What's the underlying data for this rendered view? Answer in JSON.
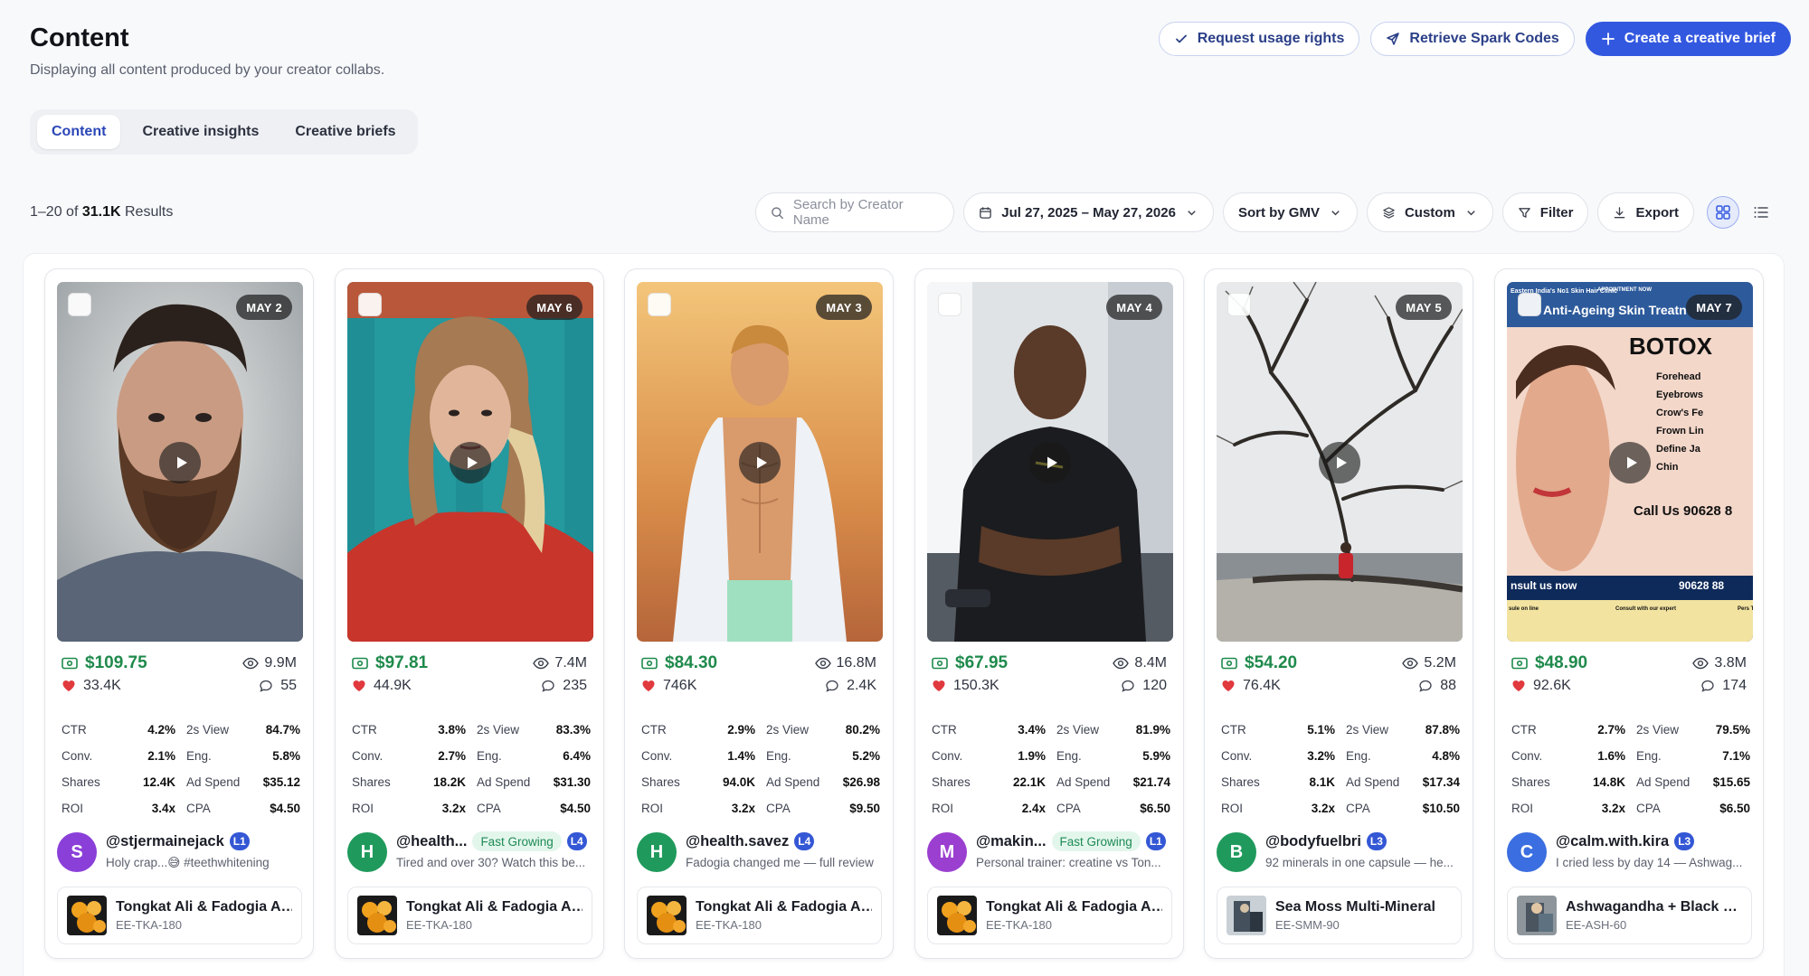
{
  "header": {
    "title": "Content",
    "subtitle": "Displaying all content produced by your creator collabs."
  },
  "actions": {
    "request_usage": "Request usage rights",
    "retrieve_spark": "Retrieve Spark Codes",
    "create_brief": "Create a creative brief"
  },
  "tabs": [
    "Content",
    "Creative insights",
    "Creative briefs"
  ],
  "results": {
    "range": "1–20 of",
    "total": "31.1K",
    "suffix": "Results"
  },
  "toolbar": {
    "search_placeholder": "Search by Creator Name",
    "date_range": "Jul 27, 2025 – May 27, 2026",
    "sort": "Sort by GMV",
    "custom": "Custom",
    "filter": "Filter",
    "export": "Export"
  },
  "metric_labels": {
    "ctr": "CTR",
    "view2s": "2s View",
    "conv": "Conv.",
    "eng": "Eng.",
    "shares": "Shares",
    "adspend": "Ad Spend",
    "roi": "ROI",
    "cpa": "CPA"
  },
  "cards": [
    {
      "date": "MAY 2",
      "gmv": "$109.75",
      "views": "9.9M",
      "likes": "33.4K",
      "comments": "55",
      "ctr": "4.2%",
      "view2s": "84.7%",
      "conv": "2.1%",
      "eng": "5.8%",
      "shares": "12.4K",
      "adspend": "$35.12",
      "roi": "3.4x",
      "cpa": "$4.50",
      "avatar_letter": "S",
      "avatar_color": "#8b3fd9",
      "handle": "@stjermainejack",
      "badge": "",
      "level": "L1",
      "caption": "Holy crap...😅 #teethwhitening",
      "product": "Tongkat Ali & Fadogia Ag...",
      "sku": "EE-TKA-180"
    },
    {
      "date": "MAY 6",
      "gmv": "$97.81",
      "views": "7.4M",
      "likes": "44.9K",
      "comments": "235",
      "ctr": "3.8%",
      "view2s": "83.3%",
      "conv": "2.7%",
      "eng": "6.4%",
      "shares": "18.2K",
      "adspend": "$31.30",
      "roi": "3.2x",
      "cpa": "$4.50",
      "avatar_letter": "H",
      "avatar_color": "#1f9a5c",
      "handle": "@health...",
      "badge": "Fast Growing",
      "level": "L4",
      "caption": "Tired and over 30? Watch this be...",
      "product": "Tongkat Ali & Fadogia Ag...",
      "sku": "EE-TKA-180"
    },
    {
      "date": "MAY 3",
      "gmv": "$84.30",
      "views": "16.8M",
      "likes": "746K",
      "comments": "2.4K",
      "ctr": "2.9%",
      "view2s": "80.2%",
      "conv": "1.4%",
      "eng": "5.2%",
      "shares": "94.0K",
      "adspend": "$26.98",
      "roi": "3.2x",
      "cpa": "$9.50",
      "avatar_letter": "H",
      "avatar_color": "#1f9a5c",
      "handle": "@health.savez",
      "badge": "",
      "level": "L4",
      "caption": "Fadogia changed me — full review",
      "product": "Tongkat Ali & Fadogia Ag...",
      "sku": "EE-TKA-180"
    },
    {
      "date": "MAY 4",
      "gmv": "$67.95",
      "views": "8.4M",
      "likes": "150.3K",
      "comments": "120",
      "ctr": "3.4%",
      "view2s": "81.9%",
      "conv": "1.9%",
      "eng": "5.9%",
      "shares": "22.1K",
      "adspend": "$21.74",
      "roi": "2.4x",
      "cpa": "$6.50",
      "avatar_letter": "M",
      "avatar_color": "#9b3fd0",
      "handle": "@makin...",
      "badge": "Fast Growing",
      "level": "L1",
      "caption": "Personal trainer: creatine vs Ton...",
      "product": "Tongkat Ali & Fadogia Ag...",
      "sku": "EE-TKA-180"
    },
    {
      "date": "MAY 5",
      "gmv": "$54.20",
      "views": "5.2M",
      "likes": "76.4K",
      "comments": "88",
      "ctr": "5.1%",
      "view2s": "87.8%",
      "conv": "3.2%",
      "eng": "4.8%",
      "shares": "8.1K",
      "adspend": "$17.34",
      "roi": "3.2x",
      "cpa": "$10.50",
      "avatar_letter": "B",
      "avatar_color": "#1f9a5c",
      "handle": "@bodyfuelbri",
      "badge": "",
      "level": "L3",
      "caption": "92 minerals in one capsule — he...",
      "product": "Sea Moss Multi-Mineral",
      "sku": "EE-SMM-90"
    },
    {
      "date": "MAY 7",
      "gmv": "$48.90",
      "views": "3.8M",
      "likes": "92.6K",
      "comments": "174",
      "ctr": "2.7%",
      "view2s": "79.5%",
      "conv": "1.6%",
      "eng": "7.1%",
      "shares": "14.8K",
      "adspend": "$15.65",
      "roi": "3.2x",
      "cpa": "$6.50",
      "avatar_letter": "C",
      "avatar_color": "#3b6ee0",
      "handle": "@calm.with.kira",
      "badge": "",
      "level": "L3",
      "caption": "I cried less by day 14 — Ashwag...",
      "product": "Ashwagandha + Black Pe...",
      "sku": "EE-ASH-60"
    }
  ],
  "ad_thumb": {
    "top_left": "Eastern India's No1 Skin Hair Clinic",
    "appointment": "APPOINTMENT NOW",
    "banner": "Anti-Ageing Skin Treatn",
    "headline": "BOTOX",
    "items": [
      "Forehead",
      "Eyebrows",
      "Crow's Fe",
      "Frown Lin",
      "Define Ja",
      "Chin"
    ],
    "call": "Call Us 90628 8",
    "consult": "nsult us now",
    "phone": "90628 88",
    "small_left": "sule on line",
    "small_mid": "Consult with our expert",
    "small_right": "Pers Trea"
  },
  "colors": {
    "accent": "#3358e0",
    "gmv_green": "#1f8a4c",
    "heart": "#e0393e",
    "level_badge": "#3457d5"
  }
}
